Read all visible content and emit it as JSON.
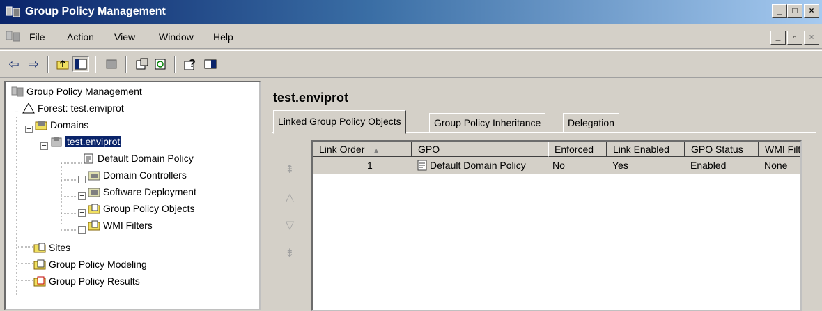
{
  "window": {
    "title": "Group Policy Management",
    "minimize_glyph": "_",
    "maximize_glyph": "□",
    "close_glyph": "×",
    "restore_glyph": "▫"
  },
  "menu": {
    "items": [
      {
        "label": "File"
      },
      {
        "label": "Action"
      },
      {
        "label": "View"
      },
      {
        "label": "Window"
      },
      {
        "label": "Help"
      }
    ]
  },
  "toolbar": {
    "back_glyph": "⇦",
    "forward_glyph": "⇨",
    "icons": [
      "up-folder-icon",
      "show-hide-tree-icon",
      "delete-icon",
      "properties-icon",
      "refresh-icon",
      "help-icon",
      "action-pane-icon"
    ]
  },
  "tree": {
    "root": "Group Policy Management",
    "forest": "Forest: test.enviprot",
    "domains": "Domains",
    "domain": "test.enviprot",
    "default_policy": "Default Domain Policy",
    "domain_controllers": "Domain Controllers",
    "software_deployment": "Software Deployment",
    "gpo": "Group Policy Objects",
    "wmi": "WMI Filters",
    "sites": "Sites",
    "modeling": "Group Policy Modeling",
    "results": "Group Policy Results"
  },
  "main": {
    "title": "test.enviprot",
    "tabs": [
      {
        "label": "Linked Group Policy Objects"
      },
      {
        "label": "Group Policy Inheritance"
      },
      {
        "label": "Delegation"
      }
    ],
    "columns": [
      "Link Order",
      "GPO",
      "Enforced",
      "Link Enabled",
      "GPO Status",
      "WMI Filt"
    ],
    "rows": [
      {
        "link_order": "1",
        "gpo": "Default Domain Policy",
        "enforced": "No",
        "link_enabled": "Yes",
        "gpo_status": "Enabled",
        "wmi": "None"
      }
    ]
  },
  "colors": {
    "title_start": "#0a246a",
    "title_end": "#a6caf0",
    "face": "#d4d0c8",
    "selection": "#0a246a"
  }
}
